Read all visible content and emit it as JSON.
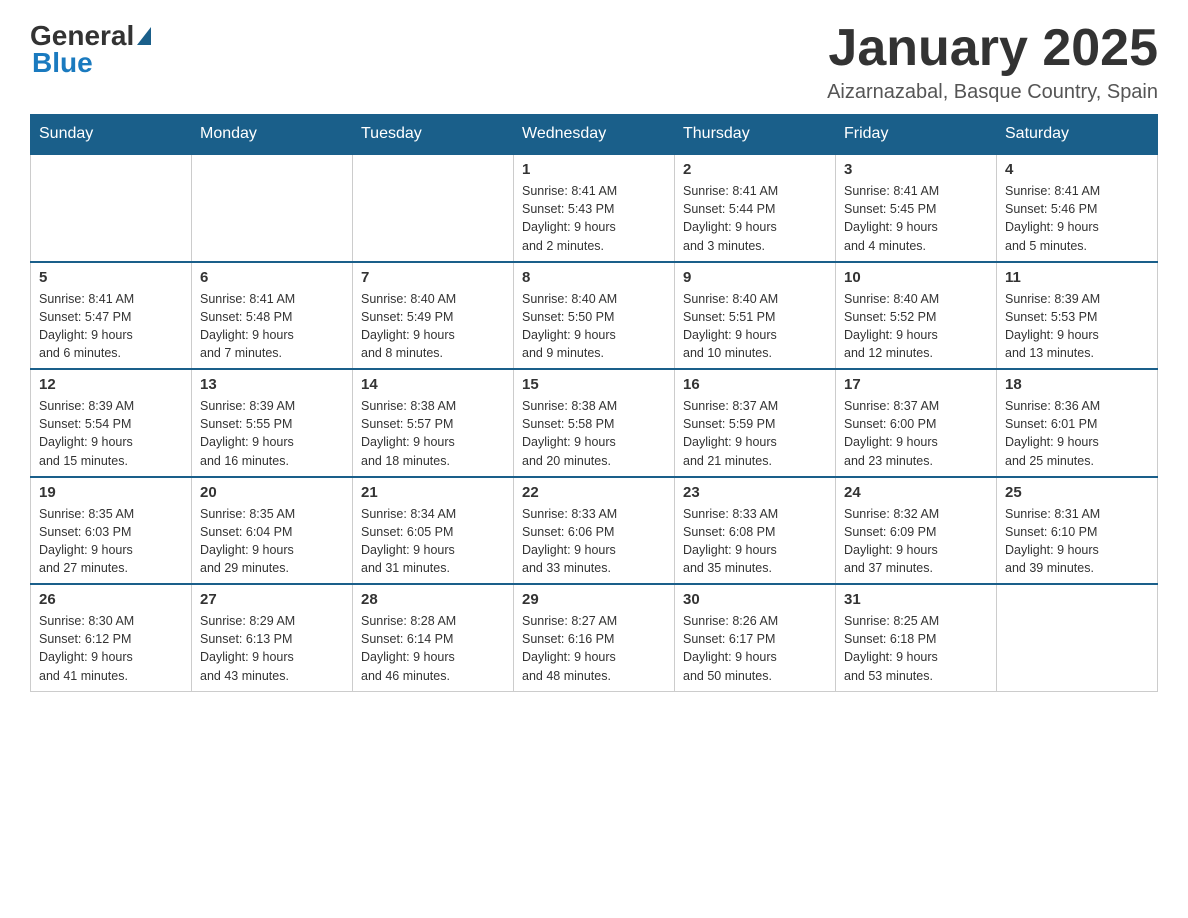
{
  "header": {
    "logo_general": "General",
    "logo_blue": "Blue",
    "month_title": "January 2025",
    "location": "Aizarnazabal, Basque Country, Spain"
  },
  "days_of_week": [
    "Sunday",
    "Monday",
    "Tuesday",
    "Wednesday",
    "Thursday",
    "Friday",
    "Saturday"
  ],
  "weeks": [
    [
      {
        "day": "",
        "info": ""
      },
      {
        "day": "",
        "info": ""
      },
      {
        "day": "",
        "info": ""
      },
      {
        "day": "1",
        "info": "Sunrise: 8:41 AM\nSunset: 5:43 PM\nDaylight: 9 hours\nand 2 minutes."
      },
      {
        "day": "2",
        "info": "Sunrise: 8:41 AM\nSunset: 5:44 PM\nDaylight: 9 hours\nand 3 minutes."
      },
      {
        "day": "3",
        "info": "Sunrise: 8:41 AM\nSunset: 5:45 PM\nDaylight: 9 hours\nand 4 minutes."
      },
      {
        "day": "4",
        "info": "Sunrise: 8:41 AM\nSunset: 5:46 PM\nDaylight: 9 hours\nand 5 minutes."
      }
    ],
    [
      {
        "day": "5",
        "info": "Sunrise: 8:41 AM\nSunset: 5:47 PM\nDaylight: 9 hours\nand 6 minutes."
      },
      {
        "day": "6",
        "info": "Sunrise: 8:41 AM\nSunset: 5:48 PM\nDaylight: 9 hours\nand 7 minutes."
      },
      {
        "day": "7",
        "info": "Sunrise: 8:40 AM\nSunset: 5:49 PM\nDaylight: 9 hours\nand 8 minutes."
      },
      {
        "day": "8",
        "info": "Sunrise: 8:40 AM\nSunset: 5:50 PM\nDaylight: 9 hours\nand 9 minutes."
      },
      {
        "day": "9",
        "info": "Sunrise: 8:40 AM\nSunset: 5:51 PM\nDaylight: 9 hours\nand 10 minutes."
      },
      {
        "day": "10",
        "info": "Sunrise: 8:40 AM\nSunset: 5:52 PM\nDaylight: 9 hours\nand 12 minutes."
      },
      {
        "day": "11",
        "info": "Sunrise: 8:39 AM\nSunset: 5:53 PM\nDaylight: 9 hours\nand 13 minutes."
      }
    ],
    [
      {
        "day": "12",
        "info": "Sunrise: 8:39 AM\nSunset: 5:54 PM\nDaylight: 9 hours\nand 15 minutes."
      },
      {
        "day": "13",
        "info": "Sunrise: 8:39 AM\nSunset: 5:55 PM\nDaylight: 9 hours\nand 16 minutes."
      },
      {
        "day": "14",
        "info": "Sunrise: 8:38 AM\nSunset: 5:57 PM\nDaylight: 9 hours\nand 18 minutes."
      },
      {
        "day": "15",
        "info": "Sunrise: 8:38 AM\nSunset: 5:58 PM\nDaylight: 9 hours\nand 20 minutes."
      },
      {
        "day": "16",
        "info": "Sunrise: 8:37 AM\nSunset: 5:59 PM\nDaylight: 9 hours\nand 21 minutes."
      },
      {
        "day": "17",
        "info": "Sunrise: 8:37 AM\nSunset: 6:00 PM\nDaylight: 9 hours\nand 23 minutes."
      },
      {
        "day": "18",
        "info": "Sunrise: 8:36 AM\nSunset: 6:01 PM\nDaylight: 9 hours\nand 25 minutes."
      }
    ],
    [
      {
        "day": "19",
        "info": "Sunrise: 8:35 AM\nSunset: 6:03 PM\nDaylight: 9 hours\nand 27 minutes."
      },
      {
        "day": "20",
        "info": "Sunrise: 8:35 AM\nSunset: 6:04 PM\nDaylight: 9 hours\nand 29 minutes."
      },
      {
        "day": "21",
        "info": "Sunrise: 8:34 AM\nSunset: 6:05 PM\nDaylight: 9 hours\nand 31 minutes."
      },
      {
        "day": "22",
        "info": "Sunrise: 8:33 AM\nSunset: 6:06 PM\nDaylight: 9 hours\nand 33 minutes."
      },
      {
        "day": "23",
        "info": "Sunrise: 8:33 AM\nSunset: 6:08 PM\nDaylight: 9 hours\nand 35 minutes."
      },
      {
        "day": "24",
        "info": "Sunrise: 8:32 AM\nSunset: 6:09 PM\nDaylight: 9 hours\nand 37 minutes."
      },
      {
        "day": "25",
        "info": "Sunrise: 8:31 AM\nSunset: 6:10 PM\nDaylight: 9 hours\nand 39 minutes."
      }
    ],
    [
      {
        "day": "26",
        "info": "Sunrise: 8:30 AM\nSunset: 6:12 PM\nDaylight: 9 hours\nand 41 minutes."
      },
      {
        "day": "27",
        "info": "Sunrise: 8:29 AM\nSunset: 6:13 PM\nDaylight: 9 hours\nand 43 minutes."
      },
      {
        "day": "28",
        "info": "Sunrise: 8:28 AM\nSunset: 6:14 PM\nDaylight: 9 hours\nand 46 minutes."
      },
      {
        "day": "29",
        "info": "Sunrise: 8:27 AM\nSunset: 6:16 PM\nDaylight: 9 hours\nand 48 minutes."
      },
      {
        "day": "30",
        "info": "Sunrise: 8:26 AM\nSunset: 6:17 PM\nDaylight: 9 hours\nand 50 minutes."
      },
      {
        "day": "31",
        "info": "Sunrise: 8:25 AM\nSunset: 6:18 PM\nDaylight: 9 hours\nand 53 minutes."
      },
      {
        "day": "",
        "info": ""
      }
    ]
  ]
}
